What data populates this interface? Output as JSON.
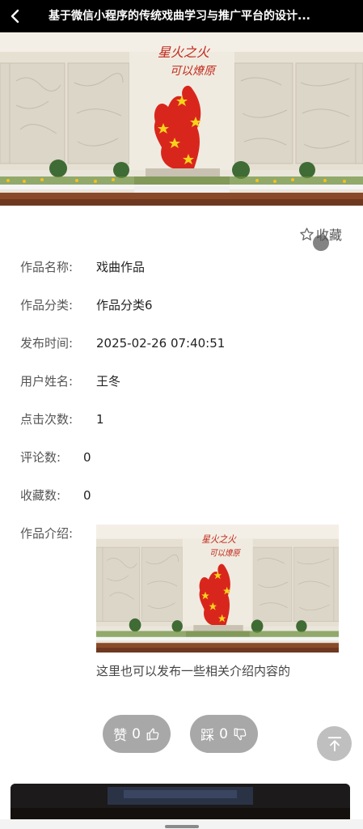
{
  "header": {
    "title": "基于微信小程序的传统戏曲学习与推广平台的设计...",
    "back_icon": "chevron-left-icon"
  },
  "banner": {
    "image": "monument-wall-photo",
    "calligraphy": [
      "星火之火",
      "可以燎原"
    ]
  },
  "favorite": {
    "icon": "star-outline-icon",
    "label": "收藏"
  },
  "details": [
    {
      "label": "作品名称:",
      "value": "戏曲作品"
    },
    {
      "label": "作品分类:",
      "value": "作品分类6"
    },
    {
      "label": "发布时间:",
      "value": "2025-02-26 07:40:51"
    },
    {
      "label": "用户姓名:",
      "value": "王冬"
    },
    {
      "label": "点击次数:",
      "value": "1"
    },
    {
      "label": "评论数:",
      "value": "0"
    },
    {
      "label": "收藏数:",
      "value": "0"
    }
  ],
  "intro": {
    "label": "作品介绍:",
    "image": "monument-wall-photo",
    "text": "这里也可以发布一些相关介绍内容的"
  },
  "actions": {
    "like": {
      "label": "赞",
      "count": "0",
      "icon": "thumbs-up-icon"
    },
    "dislike": {
      "label": "踩",
      "count": "0",
      "icon": "thumbs-down-icon"
    },
    "to_top_icon": "arrow-up-to-top-icon"
  },
  "colors": {
    "header_bg": "#000000",
    "button_bg": "#a8a8a8",
    "to_top_bg": "#bfbfbf",
    "sculpture_red": "#d9261c"
  }
}
